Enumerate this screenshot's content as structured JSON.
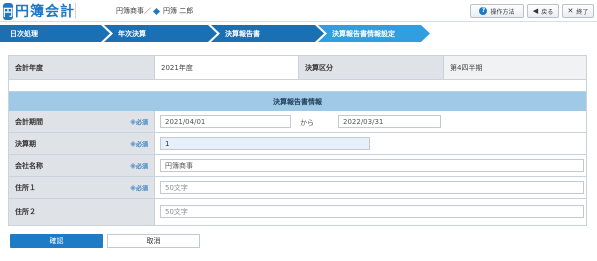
{
  "header": {
    "logo_mark": "円",
    "logo_text": "円簿会計",
    "company": "円簿商事／",
    "user": "円簿 二郎",
    "buttons": [
      {
        "icon": "?",
        "label": "操作方法"
      },
      {
        "icon": "◀",
        "label": "戻る"
      },
      {
        "icon": "✕",
        "label": "終了"
      }
    ]
  },
  "steps": [
    {
      "label": "日次処理",
      "color": "#1b6fb3"
    },
    {
      "label": "年次決算",
      "color": "#1b6fb3"
    },
    {
      "label": "決算報告書",
      "color": "#1b6fb3"
    },
    {
      "label": "決算報告書情報設定",
      "color": "#2f9fe0"
    }
  ],
  "info": {
    "fiscal_year_label": "会計年度",
    "fiscal_year_value": "2021年度",
    "settlement_type_label": "決算区分",
    "settlement_type_value": "第4四半期"
  },
  "form": {
    "section_title": "決算報告書情報",
    "required_label": "※必須",
    "period_label": "会計期間",
    "period_from": "2021/04/01",
    "period_separator": "から",
    "period_to": "2022/03/31",
    "term_label": "決算期",
    "term_value": "1",
    "company_label": "会社名称",
    "company_value": "円簿商事",
    "address1_label": "住所１",
    "address1_placeholder": "50文字",
    "address2_label": "住所２",
    "address2_placeholder": "50文字"
  },
  "footer": {
    "confirm_label": "確認",
    "cancel_label": "取消"
  }
}
